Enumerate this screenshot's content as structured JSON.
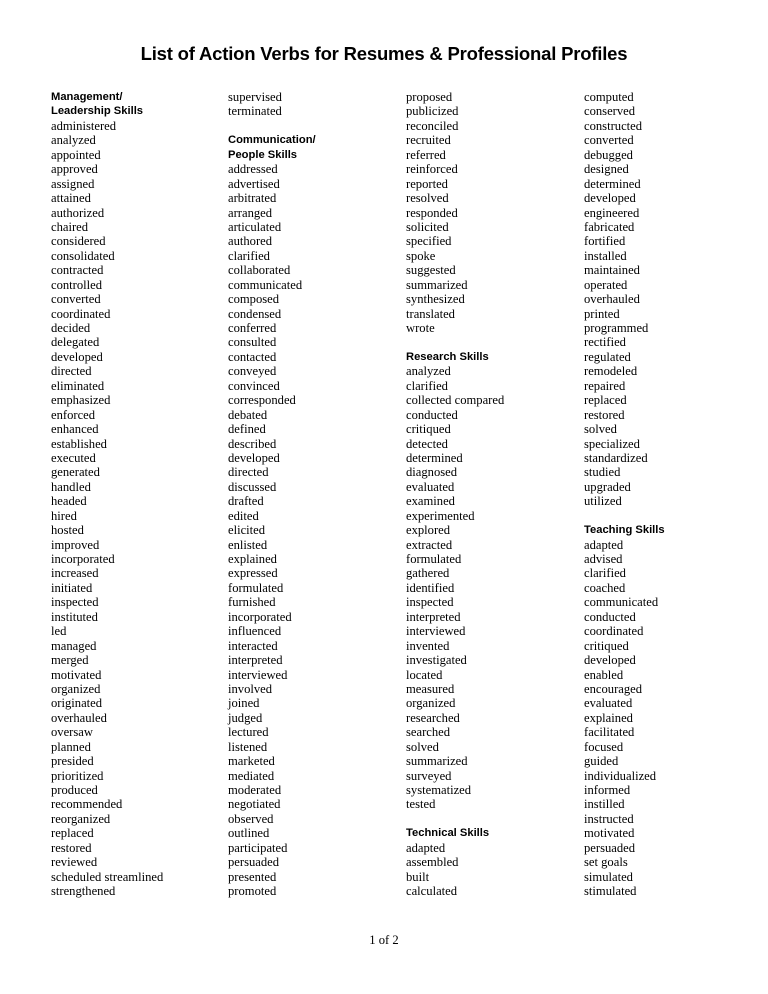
{
  "title": "List of Action Verbs for Resumes & Professional Profiles",
  "footer": {
    "page_indicator": "1 of 2"
  },
  "columns": [
    {
      "sections": [
        {
          "heading_lines": [
            "Management/",
            "Leadership Skills"
          ],
          "verbs": [
            "administered",
            "analyzed",
            "appointed",
            "approved",
            "assigned",
            "attained",
            "authorized",
            "chaired",
            "considered",
            "consolidated",
            "contracted",
            "controlled",
            "converted",
            "coordinated",
            "decided",
            "delegated",
            "developed",
            "directed",
            "eliminated",
            "emphasized",
            "enforced",
            "enhanced",
            "established",
            "executed",
            "generated",
            "handled",
            "headed",
            "hired",
            "hosted",
            "improved",
            "incorporated",
            "increased",
            "initiated",
            "inspected",
            "instituted",
            "led",
            "managed",
            "merged",
            "motivated",
            "organized",
            "originated",
            "overhauled",
            "oversaw",
            "planned",
            "presided",
            "prioritized",
            "produced",
            "recommended",
            "reorganized",
            "replaced",
            "restored",
            "reviewed",
            "scheduled streamlined",
            "strengthened"
          ]
        }
      ]
    },
    {
      "sections": [
        {
          "heading_lines": [],
          "verbs": [
            "supervised",
            "terminated"
          ]
        },
        {
          "heading_lines": [
            "Communication/",
            "People Skills"
          ],
          "verbs": [
            "addressed",
            "advertised",
            "arbitrated",
            "arranged",
            "articulated",
            "authored",
            "clarified",
            "collaborated",
            "communicated",
            "composed",
            "condensed",
            "conferred",
            "consulted",
            "contacted",
            "conveyed",
            "convinced",
            "corresponded",
            "debated",
            "defined",
            "described",
            "developed",
            "directed",
            "discussed",
            "drafted",
            "edited",
            "elicited",
            "enlisted",
            "explained",
            "expressed",
            "formulated",
            "furnished",
            "incorporated",
            "influenced",
            "interacted",
            "interpreted",
            "interviewed",
            "involved",
            "joined",
            "judged",
            "lectured",
            "listened",
            "marketed",
            "mediated",
            "moderated",
            "negotiated",
            "observed",
            "outlined",
            "participated",
            "persuaded",
            "presented",
            "promoted"
          ]
        }
      ]
    },
    {
      "sections": [
        {
          "heading_lines": [],
          "verbs": [
            "proposed",
            "publicized",
            "reconciled",
            "recruited",
            "referred",
            "reinforced",
            "reported",
            "resolved",
            "responded",
            "solicited",
            "specified",
            "spoke",
            "suggested",
            "summarized",
            "synthesized",
            "translated",
            "wrote"
          ]
        },
        {
          "heading_lines": [
            "Research Skills"
          ],
          "verbs": [
            "analyzed",
            "clarified",
            "collected compared",
            "conducted",
            "critiqued",
            "detected",
            "determined",
            "diagnosed",
            "evaluated",
            "examined",
            "experimented",
            "explored",
            "extracted",
            "formulated",
            "gathered",
            "identified",
            "inspected",
            "interpreted",
            "interviewed",
            "invented",
            "investigated",
            "located",
            "measured",
            "organized",
            "researched",
            "searched",
            "solved",
            "summarized",
            "surveyed",
            "systematized",
            "tested"
          ]
        },
        {
          "heading_lines": [
            "Technical Skills"
          ],
          "verbs": [
            "adapted",
            "assembled",
            "built",
            "calculated"
          ]
        }
      ]
    },
    {
      "sections": [
        {
          "heading_lines": [],
          "verbs": [
            "computed",
            "conserved",
            "constructed",
            "converted",
            "debugged",
            "designed",
            "determined",
            "developed",
            "engineered",
            "fabricated",
            "fortified",
            "installed",
            "maintained",
            "operated",
            "overhauled",
            "printed",
            "programmed",
            "rectified",
            "regulated",
            "remodeled",
            "repaired",
            "replaced",
            "restored",
            "solved",
            "specialized",
            "standardized",
            "studied",
            "upgraded",
            "utilized"
          ]
        },
        {
          "heading_lines": [
            "Teaching Skills"
          ],
          "verbs": [
            "adapted",
            "advised",
            "clarified",
            "coached",
            "communicated",
            "conducted",
            "coordinated",
            "critiqued",
            "developed",
            "enabled",
            "encouraged",
            "evaluated",
            "explained",
            "facilitated",
            "focused",
            "guided",
            "individualized",
            "informed",
            "instilled",
            "instructed",
            "motivated",
            "persuaded",
            "set goals",
            "simulated",
            "stimulated"
          ]
        }
      ]
    }
  ]
}
